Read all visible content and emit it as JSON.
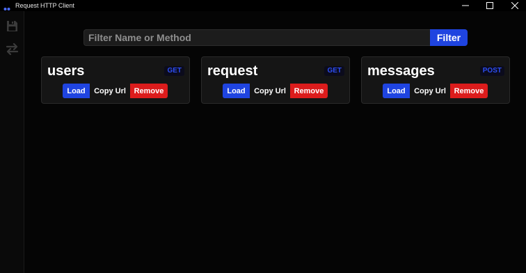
{
  "window": {
    "title": "Request HTTP Client",
    "icon": "app-logo-icon",
    "controls": [
      "minimize-icon",
      "maximize-icon",
      "close-icon"
    ]
  },
  "sidebar": {
    "items": [
      {
        "icon": "save-icon"
      },
      {
        "icon": "swap-icon"
      }
    ]
  },
  "filter": {
    "placeholder": "Filter Name or Method",
    "value": "",
    "button_label": "Filter"
  },
  "cards": [
    {
      "name": "users",
      "method": "GET"
    },
    {
      "name": "request",
      "method": "GET"
    },
    {
      "name": "messages",
      "method": "POST"
    }
  ],
  "actions": {
    "load": "Load",
    "copy": "Copy Url",
    "remove": "Remove"
  },
  "colors": {
    "background": "#050505",
    "accent": "#1f44e0",
    "danger": "#dc1c1c",
    "method": "#2d4ef2",
    "card": "#151515"
  }
}
